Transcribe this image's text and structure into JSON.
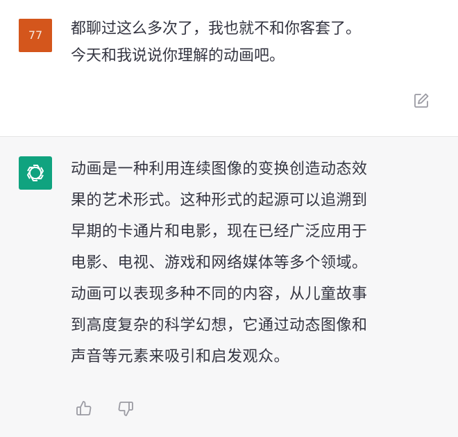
{
  "conversation": {
    "user_turn": {
      "avatar_initials": "77",
      "message": "都聊过这么多次了，我也就不和你客套了。\n今天和我说说你理解的动画吧。",
      "edit_icon": "edit-icon"
    },
    "assistant_turn": {
      "avatar_icon": "openai-logo-icon",
      "message": "动画是一种利用连续图像的变换创造动态效\n果的艺术形式。这种形式的起源可以追溯到\n早期的卡通片和电影，现在已经广泛应用于\n电影、电视、游戏和网络媒体等多个领域。\n动画可以表现多种不同的内容，从儿童故事\n到高度复杂的科学幻想，它通过动态图像和\n声音等元素来吸引和启发观众。",
      "feedback_icons": [
        "thumbs-up-icon",
        "thumbs-down-icon"
      ]
    }
  },
  "colors": {
    "user_avatar_bg": "#d4561c",
    "assistant_avatar_bg": "#10a37f",
    "assistant_turn_bg": "#f7f7f8",
    "text": "#343541",
    "icon": "#9a9aa2"
  }
}
